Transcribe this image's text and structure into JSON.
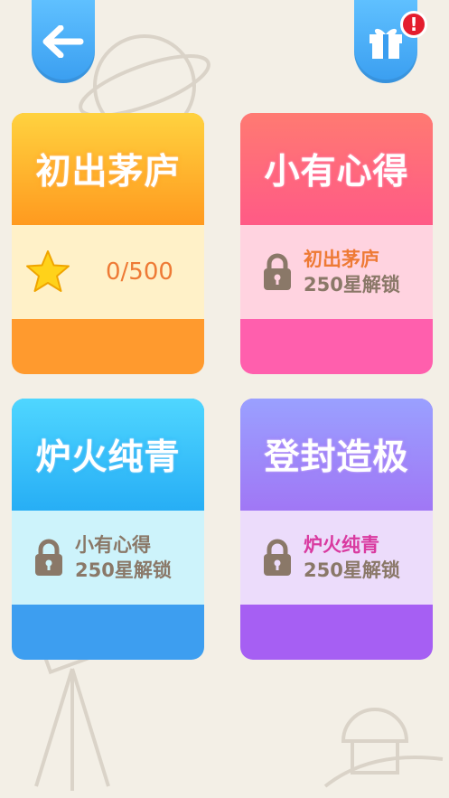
{
  "header": {
    "back_icon": "back-arrow-icon",
    "gift_icon": "gift-icon",
    "gift_badge": "!"
  },
  "levels": [
    {
      "title": "初出茅庐",
      "status": "unlocked",
      "stars": "0/500",
      "title_color": "#ffd23f",
      "title_color2": "#ff9a1f",
      "band_color": "#fff1c8",
      "base_color": "#ff9a2e"
    },
    {
      "title": "小有心得",
      "status": "locked",
      "require_level": "初出茅庐",
      "require_stars": "250星解锁",
      "title_color": "#ff7a72",
      "title_color2": "#ff5a86",
      "band_color": "#ffd3e0",
      "base_color": "#ff5fad"
    },
    {
      "title": "炉火纯青",
      "status": "locked",
      "require_level": "小有心得",
      "require_stars": "250星解锁",
      "title_color": "#4fd6ff",
      "title_color2": "#27aef5",
      "band_color": "#cdf3fb",
      "base_color": "#3d9ef0"
    },
    {
      "title": "登封造极",
      "status": "locked",
      "require_level": "炉火纯青",
      "require_stars": "250星解锁",
      "title_color": "#9aa0ff",
      "title_color2": "#a077f5",
      "band_color": "#ecdcfb",
      "base_color": "#a65ff3"
    }
  ]
}
